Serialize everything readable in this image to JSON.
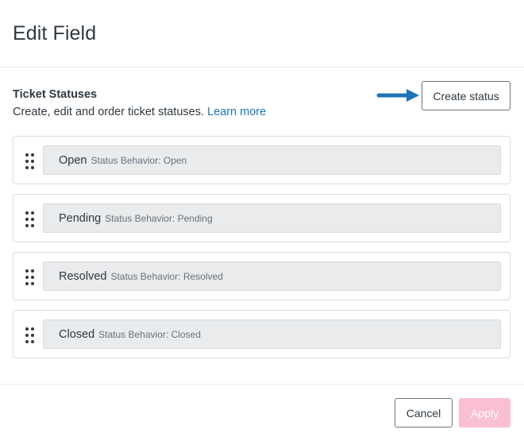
{
  "dialog": {
    "title": "Edit Field"
  },
  "section": {
    "title": "Ticket Statuses",
    "description": "Create, edit and order ticket statuses.",
    "learn_more": "Learn more",
    "create_label": "Create status"
  },
  "statuses": [
    {
      "name": "Open",
      "behavior": "Status Behavior: Open"
    },
    {
      "name": "Pending",
      "behavior": "Status Behavior: Pending"
    },
    {
      "name": "Resolved",
      "behavior": "Status Behavior: Resolved"
    },
    {
      "name": "Closed",
      "behavior": "Status Behavior: Closed"
    }
  ],
  "footer": {
    "cancel_label": "Cancel",
    "apply_label": "Apply"
  },
  "colors": {
    "link": "#1f73b7",
    "arrow": "#1f73b7",
    "apply_disabled_bg": "#f9bfd3"
  },
  "icons": {
    "drag_handle": "drag-handle-icon",
    "arrow": "arrow-right-icon"
  }
}
